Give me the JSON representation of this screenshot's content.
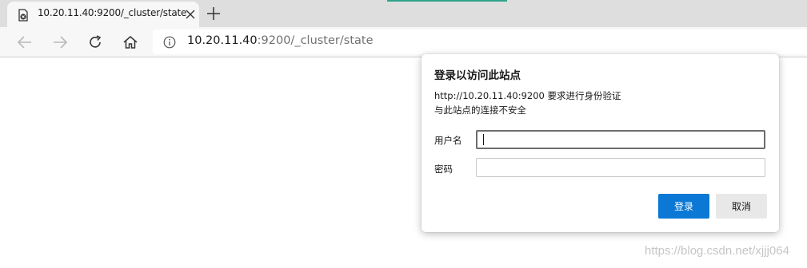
{
  "tab": {
    "title": "10.20.11.40:9200/_cluster/state",
    "favicon": "error-page-icon"
  },
  "toolbar": {
    "back_icon": "back-arrow-icon",
    "forward_icon": "forward-arrow-icon",
    "refresh_icon": "refresh-icon",
    "home_icon": "home-icon",
    "address": {
      "host": "10.20.11.40",
      "rest": ":9200/_cluster/state",
      "info_icon": "info-icon"
    }
  },
  "dialog": {
    "title": "登录以访问此站点",
    "message_line1": "http://10.20.11.40:9200 要求进行身份验证",
    "message_line2": "与此站点的连接不安全",
    "username_label": "用户名",
    "username_value": "",
    "password_label": "密码",
    "password_value": "",
    "login_button": "登录",
    "cancel_button": "取消"
  },
  "watermark": "https://blog.csdn.net/xjjj064",
  "colors": {
    "primary_button": "#0a78d4",
    "tab_accent": "#2fa38b"
  }
}
